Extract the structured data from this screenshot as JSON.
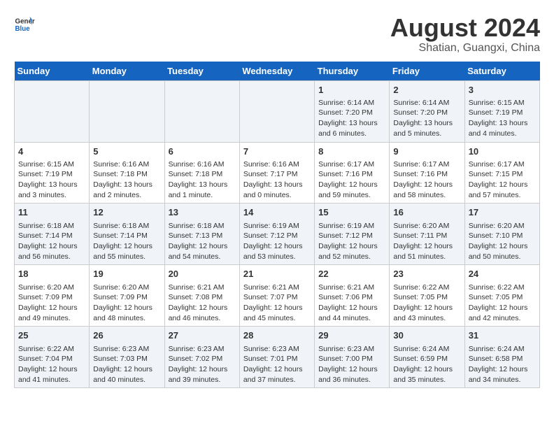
{
  "header": {
    "logo_line1": "General",
    "logo_line2": "Blue",
    "month_year": "August 2024",
    "location": "Shatian, Guangxi, China"
  },
  "days_of_week": [
    "Sunday",
    "Monday",
    "Tuesday",
    "Wednesday",
    "Thursday",
    "Friday",
    "Saturday"
  ],
  "weeks": [
    [
      {
        "day": "",
        "content": ""
      },
      {
        "day": "",
        "content": ""
      },
      {
        "day": "",
        "content": ""
      },
      {
        "day": "",
        "content": ""
      },
      {
        "day": "1",
        "content": "Sunrise: 6:14 AM\nSunset: 7:20 PM\nDaylight: 13 hours\nand 6 minutes."
      },
      {
        "day": "2",
        "content": "Sunrise: 6:14 AM\nSunset: 7:20 PM\nDaylight: 13 hours\nand 5 minutes."
      },
      {
        "day": "3",
        "content": "Sunrise: 6:15 AM\nSunset: 7:19 PM\nDaylight: 13 hours\nand 4 minutes."
      }
    ],
    [
      {
        "day": "4",
        "content": "Sunrise: 6:15 AM\nSunset: 7:19 PM\nDaylight: 13 hours\nand 3 minutes."
      },
      {
        "day": "5",
        "content": "Sunrise: 6:16 AM\nSunset: 7:18 PM\nDaylight: 13 hours\nand 2 minutes."
      },
      {
        "day": "6",
        "content": "Sunrise: 6:16 AM\nSunset: 7:18 PM\nDaylight: 13 hours\nand 1 minute."
      },
      {
        "day": "7",
        "content": "Sunrise: 6:16 AM\nSunset: 7:17 PM\nDaylight: 13 hours\nand 0 minutes."
      },
      {
        "day": "8",
        "content": "Sunrise: 6:17 AM\nSunset: 7:16 PM\nDaylight: 12 hours\nand 59 minutes."
      },
      {
        "day": "9",
        "content": "Sunrise: 6:17 AM\nSunset: 7:16 PM\nDaylight: 12 hours\nand 58 minutes."
      },
      {
        "day": "10",
        "content": "Sunrise: 6:17 AM\nSunset: 7:15 PM\nDaylight: 12 hours\nand 57 minutes."
      }
    ],
    [
      {
        "day": "11",
        "content": "Sunrise: 6:18 AM\nSunset: 7:14 PM\nDaylight: 12 hours\nand 56 minutes."
      },
      {
        "day": "12",
        "content": "Sunrise: 6:18 AM\nSunset: 7:14 PM\nDaylight: 12 hours\nand 55 minutes."
      },
      {
        "day": "13",
        "content": "Sunrise: 6:18 AM\nSunset: 7:13 PM\nDaylight: 12 hours\nand 54 minutes."
      },
      {
        "day": "14",
        "content": "Sunrise: 6:19 AM\nSunset: 7:12 PM\nDaylight: 12 hours\nand 53 minutes."
      },
      {
        "day": "15",
        "content": "Sunrise: 6:19 AM\nSunset: 7:12 PM\nDaylight: 12 hours\nand 52 minutes."
      },
      {
        "day": "16",
        "content": "Sunrise: 6:20 AM\nSunset: 7:11 PM\nDaylight: 12 hours\nand 51 minutes."
      },
      {
        "day": "17",
        "content": "Sunrise: 6:20 AM\nSunset: 7:10 PM\nDaylight: 12 hours\nand 50 minutes."
      }
    ],
    [
      {
        "day": "18",
        "content": "Sunrise: 6:20 AM\nSunset: 7:09 PM\nDaylight: 12 hours\nand 49 minutes."
      },
      {
        "day": "19",
        "content": "Sunrise: 6:20 AM\nSunset: 7:09 PM\nDaylight: 12 hours\nand 48 minutes."
      },
      {
        "day": "20",
        "content": "Sunrise: 6:21 AM\nSunset: 7:08 PM\nDaylight: 12 hours\nand 46 minutes."
      },
      {
        "day": "21",
        "content": "Sunrise: 6:21 AM\nSunset: 7:07 PM\nDaylight: 12 hours\nand 45 minutes."
      },
      {
        "day": "22",
        "content": "Sunrise: 6:21 AM\nSunset: 7:06 PM\nDaylight: 12 hours\nand 44 minutes."
      },
      {
        "day": "23",
        "content": "Sunrise: 6:22 AM\nSunset: 7:05 PM\nDaylight: 12 hours\nand 43 minutes."
      },
      {
        "day": "24",
        "content": "Sunrise: 6:22 AM\nSunset: 7:05 PM\nDaylight: 12 hours\nand 42 minutes."
      }
    ],
    [
      {
        "day": "25",
        "content": "Sunrise: 6:22 AM\nSunset: 7:04 PM\nDaylight: 12 hours\nand 41 minutes."
      },
      {
        "day": "26",
        "content": "Sunrise: 6:23 AM\nSunset: 7:03 PM\nDaylight: 12 hours\nand 40 minutes."
      },
      {
        "day": "27",
        "content": "Sunrise: 6:23 AM\nSunset: 7:02 PM\nDaylight: 12 hours\nand 39 minutes."
      },
      {
        "day": "28",
        "content": "Sunrise: 6:23 AM\nSunset: 7:01 PM\nDaylight: 12 hours\nand 37 minutes."
      },
      {
        "day": "29",
        "content": "Sunrise: 6:23 AM\nSunset: 7:00 PM\nDaylight: 12 hours\nand 36 minutes."
      },
      {
        "day": "30",
        "content": "Sunrise: 6:24 AM\nSunset: 6:59 PM\nDaylight: 12 hours\nand 35 minutes."
      },
      {
        "day": "31",
        "content": "Sunrise: 6:24 AM\nSunset: 6:58 PM\nDaylight: 12 hours\nand 34 minutes."
      }
    ]
  ]
}
